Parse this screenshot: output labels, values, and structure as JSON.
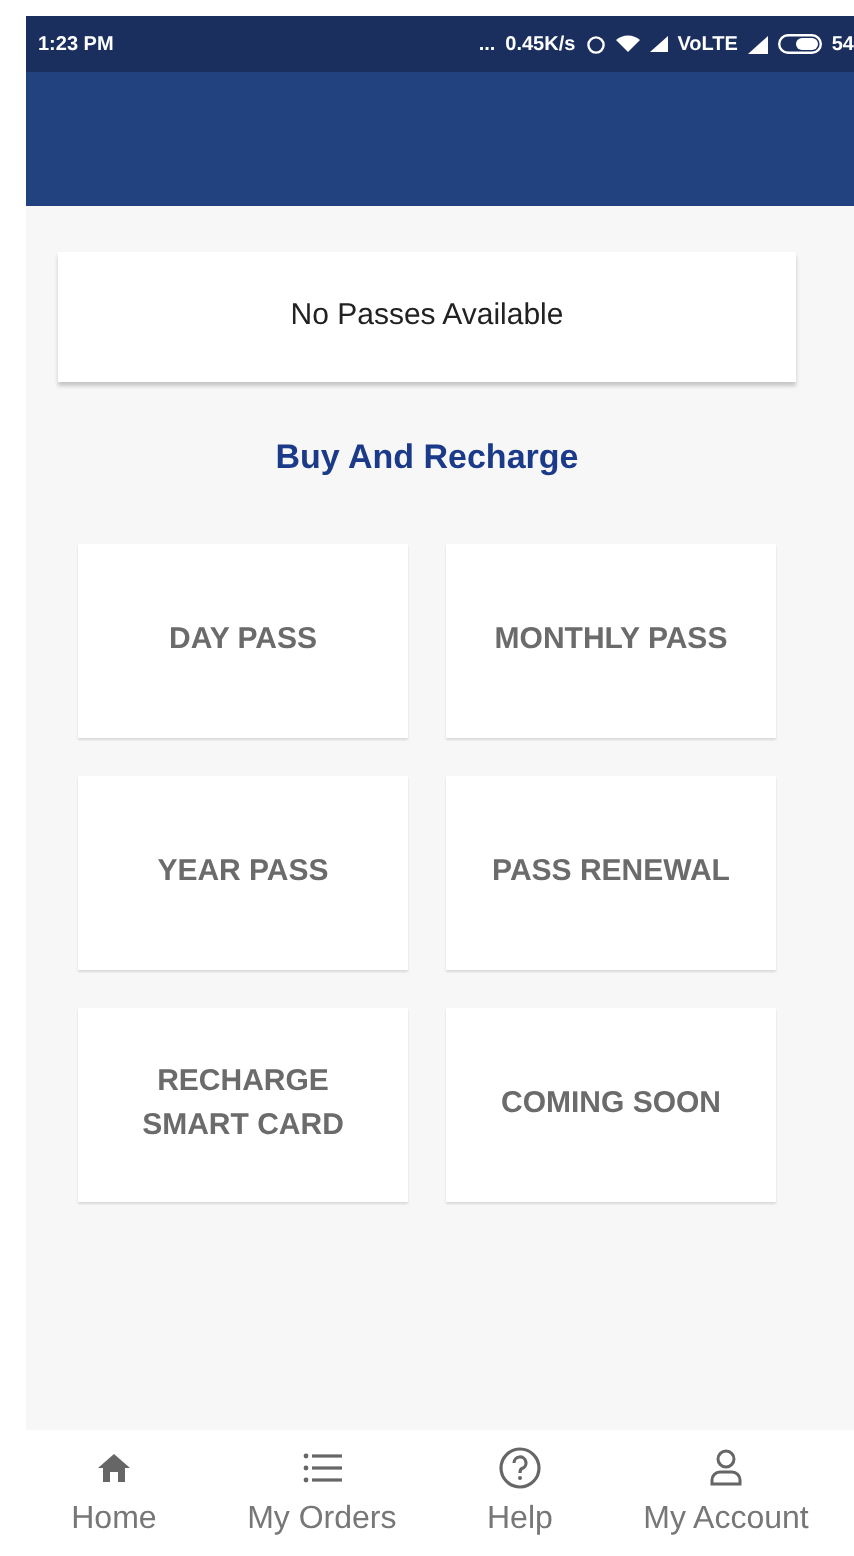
{
  "status_bar": {
    "time": "1:23 PM",
    "dots": "...",
    "speed": "0.45K/s",
    "network": "VoLTE",
    "battery": "54"
  },
  "notice": "No Passes Available",
  "section_title": "Buy And Recharge",
  "options": [
    {
      "label": "DAY PASS"
    },
    {
      "label": "MONTHLY PASS"
    },
    {
      "label": "YEAR PASS"
    },
    {
      "label": "PASS RENEWAL"
    },
    {
      "label": "RECHARGE SMART CARD"
    },
    {
      "label": "COMING SOON"
    }
  ],
  "nav": [
    {
      "kind": "home",
      "label": "Home"
    },
    {
      "kind": "orders",
      "label": "My Orders"
    },
    {
      "kind": "help",
      "label": "Help"
    },
    {
      "kind": "account",
      "label": "My Account"
    }
  ]
}
